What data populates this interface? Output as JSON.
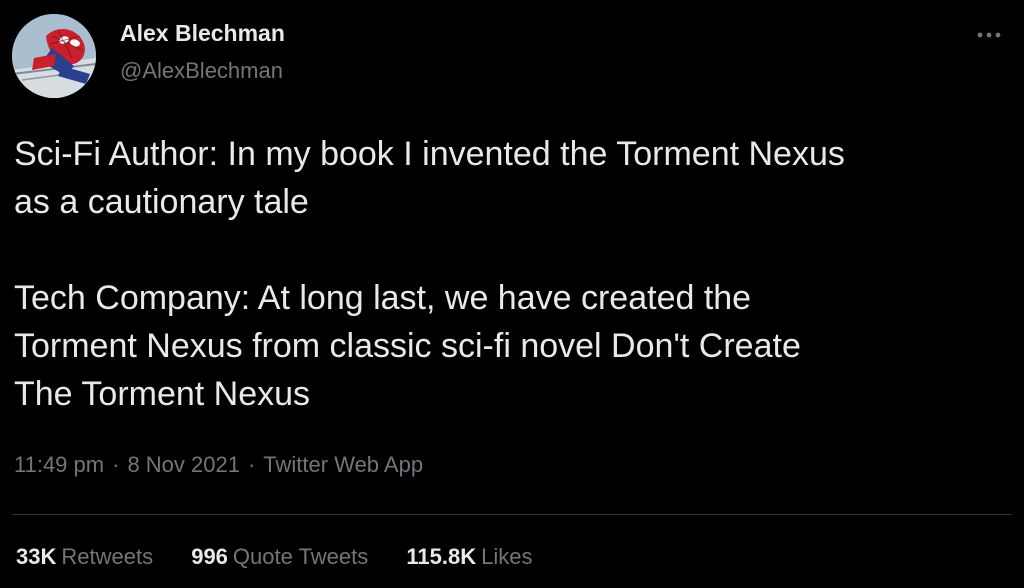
{
  "author": {
    "display_name": "Alex Blechman",
    "handle": "@AlexBlechman",
    "avatar_icon": "spiderman-avatar-icon"
  },
  "menu_icon": "more-horizontal-icon",
  "tweet": {
    "paragraphs": [
      "Sci-Fi Author: In my book I invented the Torment Nexus\nas a cautionary tale",
      "Tech Company: At long last, we have created the\nTorment Nexus from classic sci-fi novel Don't Create\nThe Torment Nexus"
    ]
  },
  "meta": {
    "time": "11:49 pm",
    "separator": "·",
    "date": "8 Nov 2021",
    "source": "Twitter Web App"
  },
  "stats": {
    "retweets": {
      "count": "33K",
      "label": "Retweets"
    },
    "quotes": {
      "count": "996",
      "label": "Quote Tweets"
    },
    "likes": {
      "count": "115.8K",
      "label": "Likes"
    }
  },
  "colors": {
    "background": "#000000",
    "primary_text": "#e7e9ea",
    "secondary_text": "#71767b",
    "divider": "#2f3336"
  }
}
